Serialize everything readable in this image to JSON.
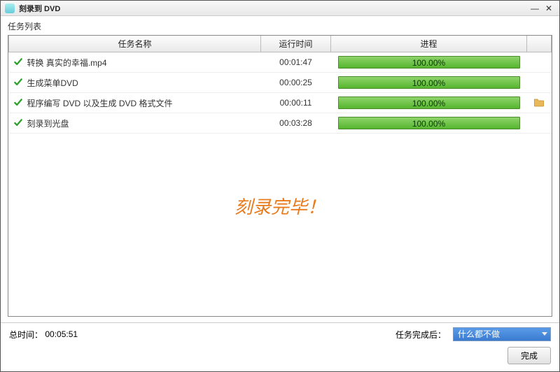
{
  "titlebar": {
    "title": "刻录到 DVD"
  },
  "section_label": "任务列表",
  "columns": {
    "name": "任务名称",
    "time": "运行时间",
    "progress": "进程"
  },
  "tasks": [
    {
      "name": "转换 真实的幸福.mp4",
      "time": "00:01:47",
      "progress_text": "100.00%",
      "progress_pct": 100,
      "folder": false
    },
    {
      "name": "生成菜单DVD",
      "time": "00:00:25",
      "progress_text": "100.00%",
      "progress_pct": 100,
      "folder": false
    },
    {
      "name": "程序编写 DVD 以及生成 DVD 格式文件",
      "time": "00:00:11",
      "progress_text": "100.00%",
      "progress_pct": 100,
      "folder": true
    },
    {
      "name": "刻录到光盘",
      "time": "00:03:28",
      "progress_text": "100.00%",
      "progress_pct": 100,
      "folder": false
    }
  ],
  "burn_note": "刻录完毕！",
  "footer": {
    "total_time_label": "总时间：",
    "total_time_value": "00:05:51",
    "after_label": "任务完成后：",
    "after_value": "什么都不做"
  },
  "buttons": {
    "done": "完成"
  }
}
